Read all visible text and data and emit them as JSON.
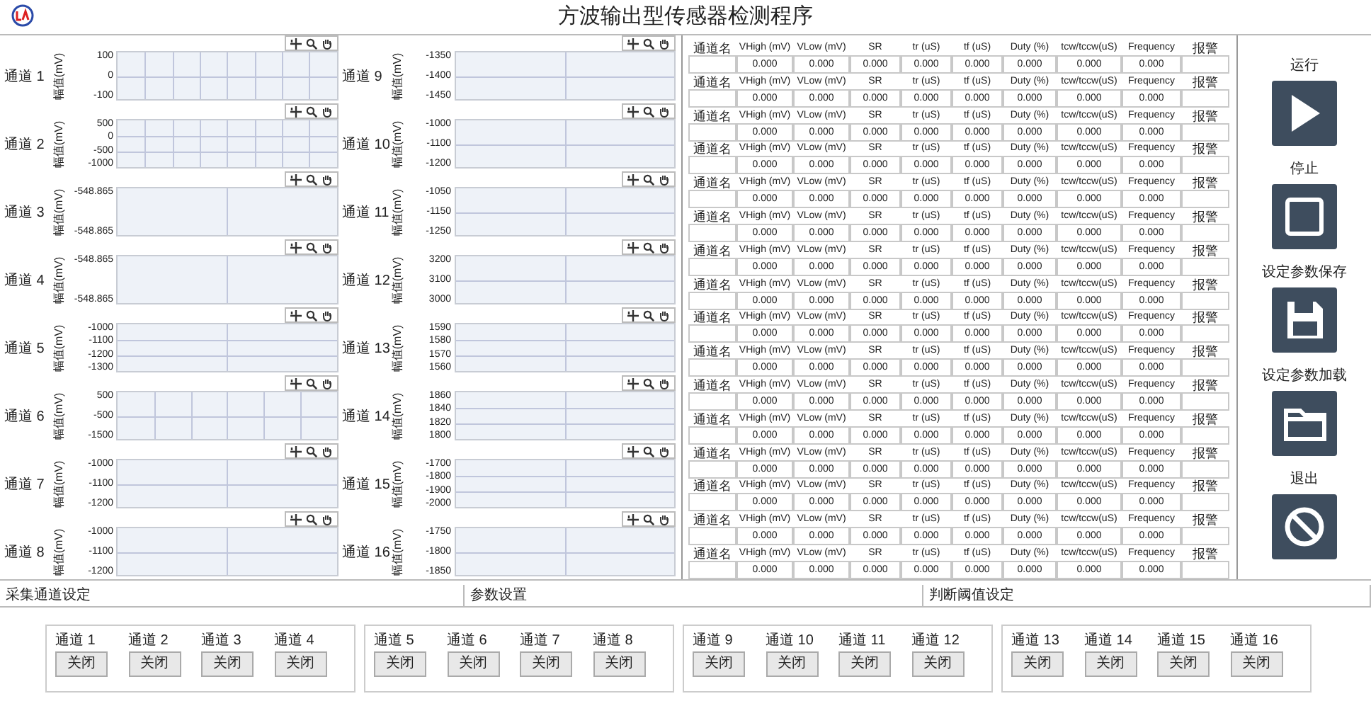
{
  "title": "方波输出型传感器检测程序",
  "charts": [
    {
      "label": "通道 1",
      "axis_label": "幅值(mV)",
      "y_ticks": [
        "100",
        "0",
        "-100"
      ],
      "kind": "dense"
    },
    {
      "label": "通道 2",
      "axis_label": "幅值(mV)",
      "y_ticks": [
        "500",
        "0",
        "-500",
        "-1000"
      ],
      "kind": "dense"
    },
    {
      "label": "通道 3",
      "axis_label": "幅值(mV)",
      "y_ticks": [
        "-548.865",
        "-548.865"
      ],
      "kind": "split"
    },
    {
      "label": "通道 4",
      "axis_label": "幅值(mV)",
      "y_ticks": [
        "-548.865",
        "-548.865"
      ],
      "kind": "split"
    },
    {
      "label": "通道 5",
      "axis_label": "幅值(mV)",
      "y_ticks": [
        "-1000",
        "-1100",
        "-1200",
        "-1300"
      ],
      "kind": "split"
    },
    {
      "label": "通道 6",
      "axis_label": "幅值(mV)",
      "y_ticks": [
        "500",
        "-500",
        "-1500"
      ],
      "kind": "medium"
    },
    {
      "label": "通道 7",
      "axis_label": "幅值(mV)",
      "y_ticks": [
        "-1000",
        "-1100",
        "-1200"
      ],
      "kind": "split"
    },
    {
      "label": "通道 8",
      "axis_label": "幅值(mV)",
      "y_ticks": [
        "-1000",
        "-1100",
        "-1200"
      ],
      "kind": "split"
    },
    {
      "label": "通道 9",
      "axis_label": "幅值(mV)",
      "y_ticks": [
        "-1350",
        "-1400",
        "-1450"
      ],
      "kind": "split"
    },
    {
      "label": "通道 10",
      "axis_label": "幅值(mV)",
      "y_ticks": [
        "-1000",
        "-1100",
        "-1200"
      ],
      "kind": "split"
    },
    {
      "label": "通道 11",
      "axis_label": "幅值(mV)",
      "y_ticks": [
        "-1050",
        "-1150",
        "-1250"
      ],
      "kind": "split"
    },
    {
      "label": "通道 12",
      "axis_label": "幅值(mV)",
      "y_ticks": [
        "3200",
        "3100",
        "3000"
      ],
      "kind": "split"
    },
    {
      "label": "通道 13",
      "axis_label": "幅值(mV)",
      "y_ticks": [
        "1590",
        "1580",
        "1570",
        "1560"
      ],
      "kind": "split"
    },
    {
      "label": "通道 14",
      "axis_label": "幅值(mV)",
      "y_ticks": [
        "1860",
        "1840",
        "1820",
        "1800"
      ],
      "kind": "split"
    },
    {
      "label": "通道 15",
      "axis_label": "幅值(mV)",
      "y_ticks": [
        "-1700",
        "-1800",
        "-1900",
        "-2000"
      ],
      "kind": "split"
    },
    {
      "label": "通道 16",
      "axis_label": "幅值(mV)",
      "y_ticks": [
        "-1750",
        "-1800",
        "-1850"
      ],
      "kind": "split"
    }
  ],
  "table": {
    "blocks": [
      {
        "headers": [
          "通道名",
          "VHigh (mV)",
          "VLow (mV)",
          "SR",
          "tr (uS)",
          "tf (uS)",
          "Duty (%)",
          "tcw/tccw(uS)",
          "Frequency",
          "报警"
        ],
        "values": [
          "0.000",
          "0.000",
          "0.000",
          "0.000",
          "0.000",
          "0.000",
          "0.000",
          "0.000"
        ]
      },
      {
        "headers": [
          "通道名",
          "VHigh (mV)",
          "VLow (mV)",
          "SR",
          "tr (uS)",
          "tf (uS)",
          "Duty (%)",
          "tcw/tccw(uS)",
          "Frequency",
          "报警"
        ],
        "values": [
          "0.000",
          "0.000",
          "0.000",
          "0.000",
          "0.000",
          "0.000",
          "0.000",
          "0.000"
        ]
      },
      {
        "headers": [
          "通道名",
          "VHigh (mV)",
          "VLow (mV)",
          "SR",
          "tr (uS)",
          "tf (uS)",
          "Duty (%)",
          "tcw/tccw(uS)",
          "Frequency",
          "报警"
        ],
        "values": [
          "0.000",
          "0.000",
          "0.000",
          "0.000",
          "0.000",
          "0.000",
          "0.000",
          "0.000"
        ]
      },
      {
        "headers": [
          "通道名",
          "VHigh (mV)",
          "VLow (mV)",
          "SR",
          "tr (uS)",
          "tf (uS)",
          "Duty (%)",
          "tcw/tccw(uS)",
          "Frequency",
          "报警"
        ],
        "values": [
          "0.000",
          "0.000",
          "0.000",
          "0.000",
          "0.000",
          "0.000",
          "0.000",
          "0.000"
        ]
      },
      {
        "headers": [
          "通道名",
          "VHigh (mV)",
          "VLow (mV)",
          "SR",
          "tr (uS)",
          "tf (uS)",
          "Duty (%)",
          "tcw/tccw(uS)",
          "Frequency",
          "报警"
        ],
        "values": [
          "0.000",
          "0.000",
          "0.000",
          "0.000",
          "0.000",
          "0.000",
          "0.000",
          "0.000"
        ]
      },
      {
        "headers": [
          "通道名",
          "VHigh (mV)",
          "VLow (mV)",
          "SR",
          "tr (uS)",
          "tf (uS)",
          "Duty (%)",
          "tcw/tccw(uS)",
          "Frequency",
          "报警"
        ],
        "values": [
          "0.000",
          "0.000",
          "0.000",
          "0.000",
          "0.000",
          "0.000",
          "0.000",
          "0.000"
        ]
      },
      {
        "headers": [
          "通道名",
          "VHigh (mV)",
          "VLow (mV)",
          "SR",
          "tr (uS)",
          "tf (uS)",
          "Duty (%)",
          "tcw/tccw(uS)",
          "Frequency",
          "报警"
        ],
        "values": [
          "0.000",
          "0.000",
          "0.000",
          "0.000",
          "0.000",
          "0.000",
          "0.000",
          "0.000"
        ]
      },
      {
        "headers": [
          "通道名",
          "VHigh (mV)",
          "VLow (mV)",
          "SR",
          "tr (uS)",
          "tf (uS)",
          "Duty (%)",
          "tcw/tccw(uS)",
          "Frequency",
          "报警"
        ],
        "values": [
          "0.000",
          "0.000",
          "0.000",
          "0.000",
          "0.000",
          "0.000",
          "0.000",
          "0.000"
        ]
      },
      {
        "headers": [
          "通道名",
          "VHigh (mV)",
          "VLow (mV)",
          "SR",
          "tr (uS)",
          "tf (uS)",
          "Duty (%)",
          "tcw/tccw(uS)",
          "Frequency",
          "报警"
        ],
        "values": [
          "0.000",
          "0.000",
          "0.000",
          "0.000",
          "0.000",
          "0.000",
          "0.000",
          "0.000"
        ]
      },
      {
        "headers": [
          "通道名",
          "VHigh (mV)",
          "VLow (mV)",
          "SR",
          "tr (uS)",
          "tf (uS)",
          "Duty (%)",
          "tcw/tccw(uS)",
          "Frequency",
          "报警"
        ],
        "values": [
          "0.000",
          "0.000",
          "0.000",
          "0.000",
          "0.000",
          "0.000",
          "0.000",
          "0.000"
        ]
      },
      {
        "headers": [
          "通道名",
          "VHigh (mV)",
          "VLow (mV)",
          "SR",
          "tr (uS)",
          "tf (uS)",
          "Duty (%)",
          "tcw/tccw(uS)",
          "Frequency",
          "报警"
        ],
        "values": [
          "0.000",
          "0.000",
          "0.000",
          "0.000",
          "0.000",
          "0.000",
          "0.000",
          "0.000"
        ]
      },
      {
        "headers": [
          "通道名",
          "VHigh (mV)",
          "VLow (mV)",
          "SR",
          "tr (uS)",
          "tf (uS)",
          "Duty (%)",
          "tcw/tccw(uS)",
          "Frequency",
          "报警"
        ],
        "values": [
          "0.000",
          "0.000",
          "0.000",
          "0.000",
          "0.000",
          "0.000",
          "0.000",
          "0.000"
        ]
      },
      {
        "headers": [
          "通道名",
          "VHigh (mV)",
          "VLow (mV)",
          "SR",
          "tr (uS)",
          "tf (uS)",
          "Duty (%)",
          "tcw/tccw(uS)",
          "Frequency",
          "报警"
        ],
        "values": [
          "0.000",
          "0.000",
          "0.000",
          "0.000",
          "0.000",
          "0.000",
          "0.000",
          "0.000"
        ]
      },
      {
        "headers": [
          "通道名",
          "VHigh (mV)",
          "VLow (mV)",
          "SR",
          "tr (uS)",
          "tf (uS)",
          "Duty (%)",
          "tcw/tccw(uS)",
          "Frequency",
          "报警"
        ],
        "values": [
          "0.000",
          "0.000",
          "0.000",
          "0.000",
          "0.000",
          "0.000",
          "0.000",
          "0.000"
        ]
      },
      {
        "headers": [
          "通道名",
          "VHigh (mV)",
          "VLow (mV)",
          "SR",
          "tr (uS)",
          "tf (uS)",
          "Duty (%)",
          "tcw/tccw(uS)",
          "Frequency",
          "报警"
        ],
        "values": [
          "0.000",
          "0.000",
          "0.000",
          "0.000",
          "0.000",
          "0.000",
          "0.000",
          "0.000"
        ]
      },
      {
        "headers": [
          "通道名",
          "VHigh (mV)",
          "VLow (mV)",
          "SR",
          "tr (uS)",
          "tf (uS)",
          "Duty (%)",
          "tcw/tccw(uS)",
          "Frequency",
          "报警"
        ],
        "values": [
          "0.000",
          "0.000",
          "0.000",
          "0.000",
          "0.000",
          "0.000",
          "0.000",
          "0.000"
        ]
      }
    ]
  },
  "controls": [
    {
      "label": "运行",
      "kind": "run"
    },
    {
      "label": "停止",
      "kind": "stop"
    },
    {
      "label": "设定参数保存",
      "kind": "save"
    },
    {
      "label": "设定参数加载",
      "kind": "load"
    },
    {
      "label": "退出",
      "kind": "exit"
    }
  ],
  "sections": [
    "采集通道设定",
    "参数设置",
    "判断阈值设定"
  ],
  "channel_groups": [
    {
      "channels": [
        {
          "label": "通道 1",
          "button": "关闭"
        },
        {
          "label": "通道 2",
          "button": "关闭"
        },
        {
          "label": "通道 3",
          "button": "关闭"
        },
        {
          "label": "通道 4",
          "button": "关闭"
        }
      ]
    },
    {
      "channels": [
        {
          "label": "通道 5",
          "button": "关闭"
        },
        {
          "label": "通道 6",
          "button": "关闭"
        },
        {
          "label": "通道 7",
          "button": "关闭"
        },
        {
          "label": "通道 8",
          "button": "关闭"
        }
      ]
    },
    {
      "channels": [
        {
          "label": "通道 9",
          "button": "关闭"
        },
        {
          "label": "通道 10",
          "button": "关闭"
        },
        {
          "label": "通道 11",
          "button": "关闭"
        },
        {
          "label": "通道 12",
          "button": "关闭"
        }
      ]
    },
    {
      "channels": [
        {
          "label": "通道 13",
          "button": "关闭"
        },
        {
          "label": "通道 14",
          "button": "关闭"
        },
        {
          "label": "通道 15",
          "button": "关闭"
        },
        {
          "label": "通道 16",
          "button": "关闭"
        }
      ]
    }
  ]
}
